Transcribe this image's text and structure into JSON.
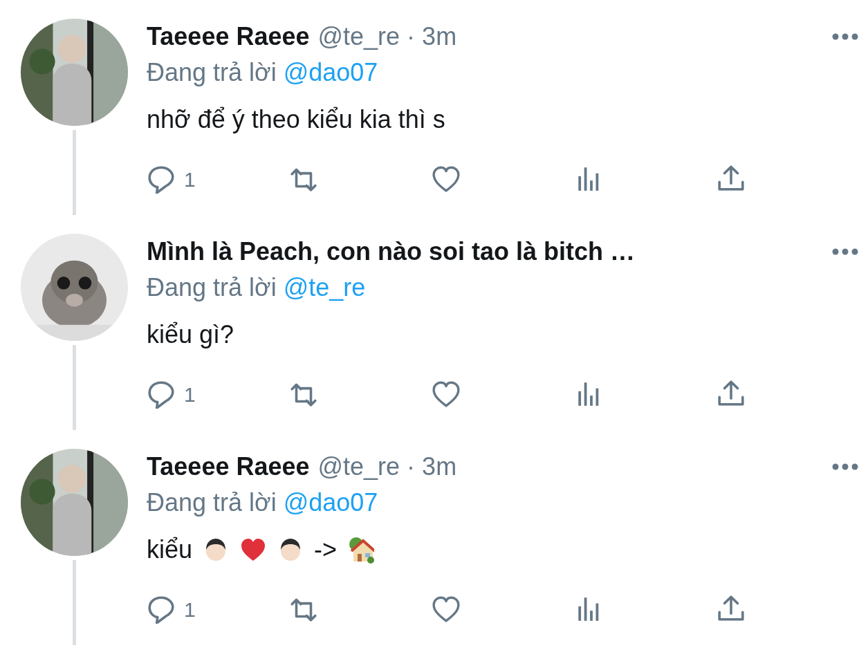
{
  "tweets": [
    {
      "name": "Taeeee Raeee",
      "handle": "@te_re",
      "separator": "·",
      "time": "3m",
      "replying_label": "Đang trả lời",
      "replying_to": "@dao07",
      "thread_line": true,
      "text_parts": [
        {
          "kind": "text",
          "text": "nhỡ để ý theo kiểu kia thì s"
        }
      ],
      "reply_count": "1"
    },
    {
      "name": "Mình là Peach, con nào soi tao là bitch …",
      "replying_label": "Đang trả lời",
      "replying_to": "@te_re",
      "thread_line": true,
      "text_parts": [
        {
          "kind": "text",
          "text": "kiểu gì?"
        }
      ],
      "reply_count": "1"
    },
    {
      "name": "Taeeee Raeee",
      "handle": "@te_re",
      "separator": "·",
      "time": "3m",
      "replying_label": "Đang trả lời",
      "replying_to": "@dao07",
      "thread_line": true,
      "text_parts": [
        {
          "kind": "text",
          "text": "kiểu"
        },
        {
          "kind": "person"
        },
        {
          "kind": "heart"
        },
        {
          "kind": "person"
        },
        {
          "kind": "text",
          "text": "->"
        },
        {
          "kind": "house"
        }
      ],
      "reply_count": "1"
    }
  ]
}
